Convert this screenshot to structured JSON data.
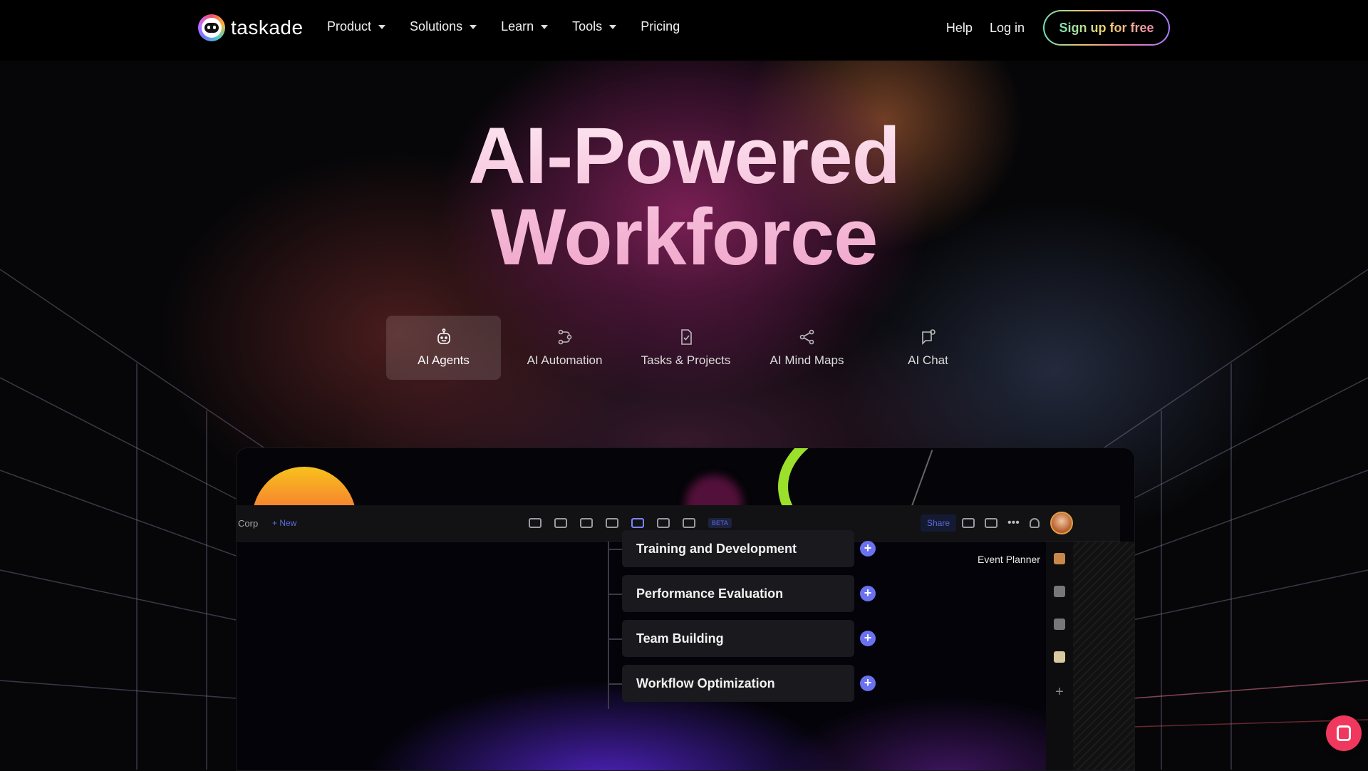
{
  "nav": {
    "logo_text": "taskade",
    "menu": [
      {
        "label": "Product",
        "dropdown": true
      },
      {
        "label": "Solutions",
        "dropdown": true
      },
      {
        "label": "Learn",
        "dropdown": true
      },
      {
        "label": "Tools",
        "dropdown": true
      },
      {
        "label": "Pricing",
        "dropdown": false
      }
    ],
    "help": "Help",
    "login": "Log in",
    "signup": "Sign up for free"
  },
  "hero": {
    "title_line1": "AI-Powered",
    "title_line2": "Workforce"
  },
  "tabs": [
    {
      "label": "AI Agents",
      "icon": "robot-icon",
      "active": true
    },
    {
      "label": "AI Automation",
      "icon": "automation-icon",
      "active": false
    },
    {
      "label": "Tasks & Projects",
      "icon": "tasks-icon",
      "active": false
    },
    {
      "label": "AI Mind Maps",
      "icon": "mindmap-icon",
      "active": false
    },
    {
      "label": "AI Chat",
      "icon": "chat-icon",
      "active": false
    }
  ],
  "preview": {
    "workspace": "Corp",
    "new_label": "+ New",
    "beta_label": "BETA",
    "share_label": "Share",
    "agent_label": "Event Planner",
    "nodes": [
      "Training and Development",
      "Performance Evaluation",
      "Team Building",
      "Workflow Optimization"
    ]
  },
  "colors": {
    "accent_pink": "#f0385e",
    "node_plus": "#6a72f0",
    "signup_gradient": [
      "#6fe0c0",
      "#f2c46d",
      "#f27ab0",
      "#a77bff"
    ]
  }
}
